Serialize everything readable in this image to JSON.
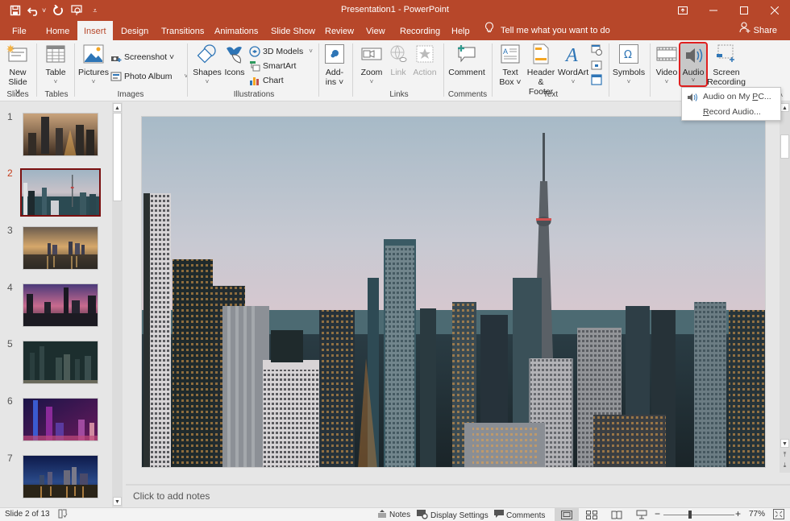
{
  "app": {
    "title": "Presentation1  -  PowerPoint",
    "accent": "#b7472a"
  },
  "qat": {
    "save_icon": "save-icon",
    "undo_icon": "undo-icon",
    "redo_icon": "redo-icon",
    "present_icon": "start-from-beginning-icon",
    "customize_icon": "customize-qat-icon"
  },
  "window_buttons": {
    "ribbon_display": "ribbon-display-options-icon",
    "minimize": "minimize-icon",
    "maximize": "maximize-icon",
    "close": "close-icon"
  },
  "tabs": [
    {
      "label": "File"
    },
    {
      "label": "Home"
    },
    {
      "label": "Insert",
      "active": true
    },
    {
      "label": "Design"
    },
    {
      "label": "Transitions"
    },
    {
      "label": "Animations"
    },
    {
      "label": "Slide Show"
    },
    {
      "label": "Review"
    },
    {
      "label": "View"
    },
    {
      "label": "Recording"
    },
    {
      "label": "Help"
    }
  ],
  "tellme": {
    "placeholder": "Tell me what you want to do"
  },
  "share": {
    "label": "Share"
  },
  "ribbon": {
    "groups": {
      "slides": "Slides",
      "tables": "Tables",
      "images": "Images",
      "illustrations": "Illustrations",
      "links": "Links",
      "comments": "Comments",
      "text": "Text"
    },
    "buttons": {
      "new_slide": [
        "New",
        "Slide ˅"
      ],
      "table": [
        "Table",
        "˅"
      ],
      "pictures": [
        "Pictures",
        "˅"
      ],
      "screenshot": "Screenshot ˅",
      "photo_album": "Photo Album",
      "shapes": [
        "Shapes",
        "˅"
      ],
      "icons": "Icons",
      "models3d": "3D Models",
      "smartart": "SmartArt",
      "chart": "Chart",
      "addins": [
        "Add-",
        "ins ˅"
      ],
      "zoom": [
        "Zoom",
        "˅"
      ],
      "link": "Link",
      "action": "Action",
      "comment": "Comment",
      "textbox": [
        "Text",
        "Box ˅"
      ],
      "header_footer": [
        "Header",
        "& Footer"
      ],
      "wordart": [
        "WordArt",
        "˅"
      ],
      "symbols": [
        "Symbols",
        "˅"
      ],
      "video": [
        "Video",
        "˅"
      ],
      "audio": [
        "Audio",
        "˅"
      ],
      "screen_recording": [
        "Screen",
        "Recording"
      ]
    }
  },
  "audio_menu": {
    "items": [
      {
        "pre": "Audio on My ",
        "u": "P",
        "post": "C..."
      },
      {
        "pre": "",
        "u": "R",
        "post": "ecord Audio..."
      }
    ]
  },
  "thumbnails": [
    {
      "number": "1",
      "theme": "warm-night-city"
    },
    {
      "number": "2",
      "theme": "toronto-skyline-dusk",
      "active": true
    },
    {
      "number": "3",
      "theme": "golden-waterfront"
    },
    {
      "number": "4",
      "theme": "purple-sunset-skyline"
    },
    {
      "number": "5",
      "theme": "dark-teal-city"
    },
    {
      "number": "6",
      "theme": "neon-purple-towers"
    },
    {
      "number": "7",
      "theme": "blue-night-bay"
    }
  ],
  "slide": {
    "content": "Toronto skyline photo with CN Tower at dusk"
  },
  "notes": {
    "placeholder": "Click to add notes"
  },
  "status": {
    "slide_counter": "Slide 2 of 13",
    "notes": "Notes",
    "display_settings": "Display Settings",
    "comments": "Comments",
    "zoom_level": "77%",
    "zoom_fraction": 0.77
  }
}
